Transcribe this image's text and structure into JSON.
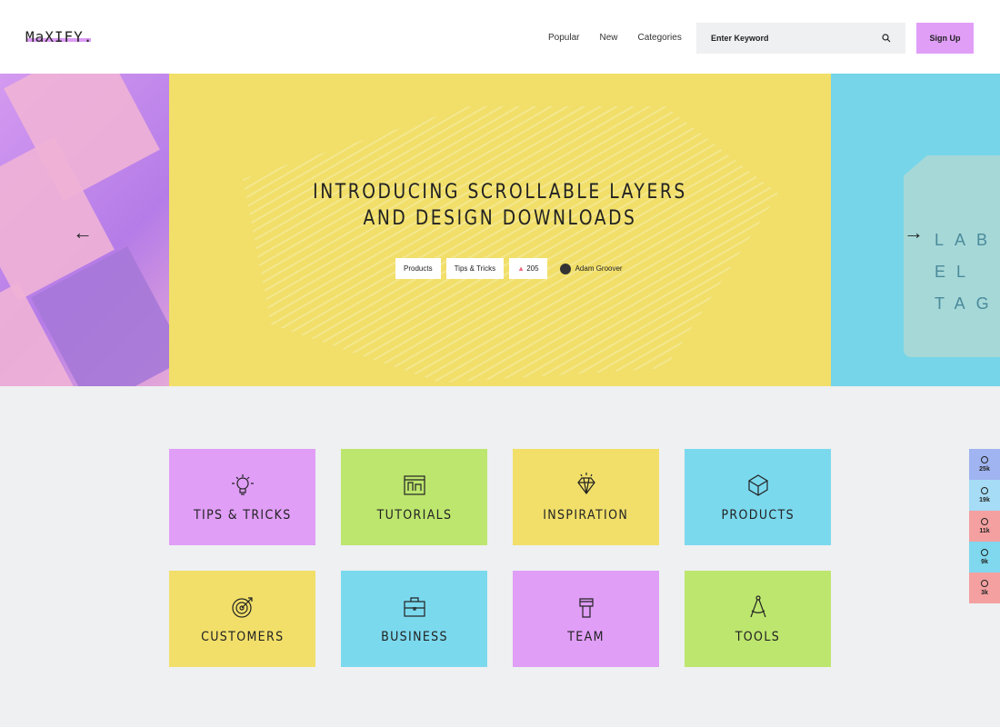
{
  "header": {
    "logo": "MaXIFY.",
    "nav": [
      "Popular",
      "New",
      "Categories"
    ],
    "search_placeholder": "Enter Keyword",
    "signup": "Sign Up"
  },
  "hero": {
    "title_line1": "INTRODUCING SCROLLABLE LAYERS",
    "title_line2": "AND DESIGN DOWNLOADS",
    "tags": [
      "Products",
      "Tips & Tricks"
    ],
    "likes": "205",
    "author": "Adam Groover",
    "right_label": "LAB EL TAG"
  },
  "categories": [
    {
      "label": "TIPS & TRICKS",
      "icon": "lightbulb-icon",
      "color": "#e09ef7"
    },
    {
      "label": "TUTORIALS",
      "icon": "blueprint-icon",
      "color": "#bde66e"
    },
    {
      "label": "INSPIRATION",
      "icon": "diamond-icon",
      "color": "#f1df6a"
    },
    {
      "label": "PRODUCTS",
      "icon": "cube-icon",
      "color": "#7bd9ee"
    },
    {
      "label": "CUSTOMERS",
      "icon": "target-icon",
      "color": "#f1df6a"
    },
    {
      "label": "BUSINESS",
      "icon": "briefcase-icon",
      "color": "#7bd9ee"
    },
    {
      "label": "TEAM",
      "icon": "fist-icon",
      "color": "#e09ef7"
    },
    {
      "label": "TOOLS",
      "icon": "compass-icon",
      "color": "#bde66e"
    }
  ],
  "social": [
    {
      "name": "facebook-icon",
      "count": "25k",
      "color": "#9fb4f0"
    },
    {
      "name": "twitter-icon",
      "count": "19k",
      "color": "#a6dcf5"
    },
    {
      "name": "dribbble-icon",
      "count": "11k",
      "color": "#f4a0a0"
    },
    {
      "name": "behance-icon",
      "count": "9k",
      "color": "#7fd8ee"
    },
    {
      "name": "pinterest-icon",
      "count": "3k",
      "color": "#f4a0a0"
    }
  ]
}
